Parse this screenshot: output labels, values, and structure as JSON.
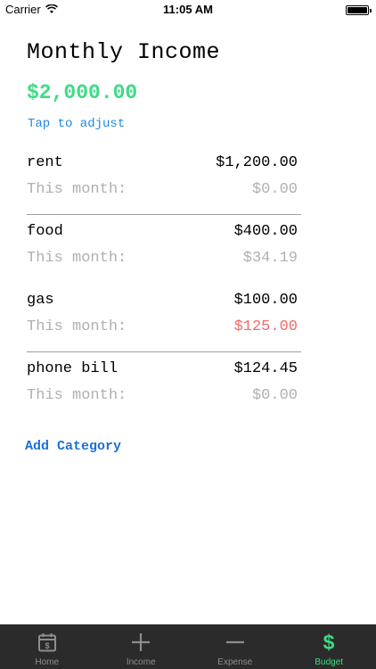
{
  "status_bar": {
    "carrier": "Carrier",
    "time": "11:05 AM"
  },
  "header": {
    "title": "Monthly Income",
    "total": "$2,000.00",
    "adjust_label": "Tap to adjust"
  },
  "categories": [
    {
      "name": "rent",
      "amount": "$1,200.00",
      "spent_label": "This month:",
      "spent": "$0.00"
    },
    {
      "name": "food",
      "amount": "$400.00",
      "spent_label": "This month:",
      "spent": "$34.19"
    },
    {
      "name": "gas",
      "amount": "$100.00",
      "spent_label": "This month:",
      "spent": "$125.00"
    },
    {
      "name": "phone bill",
      "amount": "$124.45",
      "spent_label": "This month:",
      "spent": "$0.00"
    }
  ],
  "add_category_label": "Add Category",
  "tabs": [
    {
      "label": "Home",
      "icon": "calendar-icon"
    },
    {
      "label": "Income",
      "icon": "plus-icon"
    },
    {
      "label": "Expense",
      "icon": "minus-icon"
    },
    {
      "label": "Budget",
      "icon": "dollar-icon",
      "active": true
    }
  ],
  "colors": {
    "accent_green": "#3ddc84",
    "link_blue": "#1e88e5",
    "over_budget_red": "#f06b6b",
    "tabbar_bg": "#2b2b2b"
  }
}
